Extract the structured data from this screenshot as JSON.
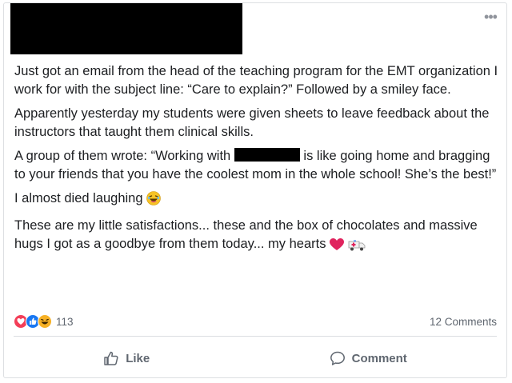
{
  "post": {
    "menu_icon": "more-horizontal-icon",
    "paragraph_1": "Just got an email from the head of the teaching program for the EMT organization I work for with the subject line: “Care to explain?” Followed by a smiley face.",
    "paragraph_2": "Apparently yesterday my students were given sheets to leave feedback about the instructors that taught them clinical skills.",
    "paragraph_3_before": "A group of them wrote: “Working with ",
    "paragraph_3_after": " is like going home and bragging to your friends that you have the coolest mom in the whole school! She’s the best!”",
    "paragraph_4": "I almost died laughing ",
    "paragraph_5": "These are my little satisfactions... these and the box of chocolates and massive hugs I got as a goodbye from them today... my hearts "
  },
  "reactions": {
    "count": "113",
    "comments": "12 Comments",
    "icons": [
      "love-reaction-icon",
      "like-reaction-icon",
      "haha-reaction-icon"
    ]
  },
  "actions": {
    "like_label": "Like",
    "comment_label": "Comment"
  },
  "colors": {
    "like_blue": "#1877f2",
    "love_red": "#f33e58",
    "haha_yellow": "#f7b125",
    "muted_text": "#606770"
  }
}
